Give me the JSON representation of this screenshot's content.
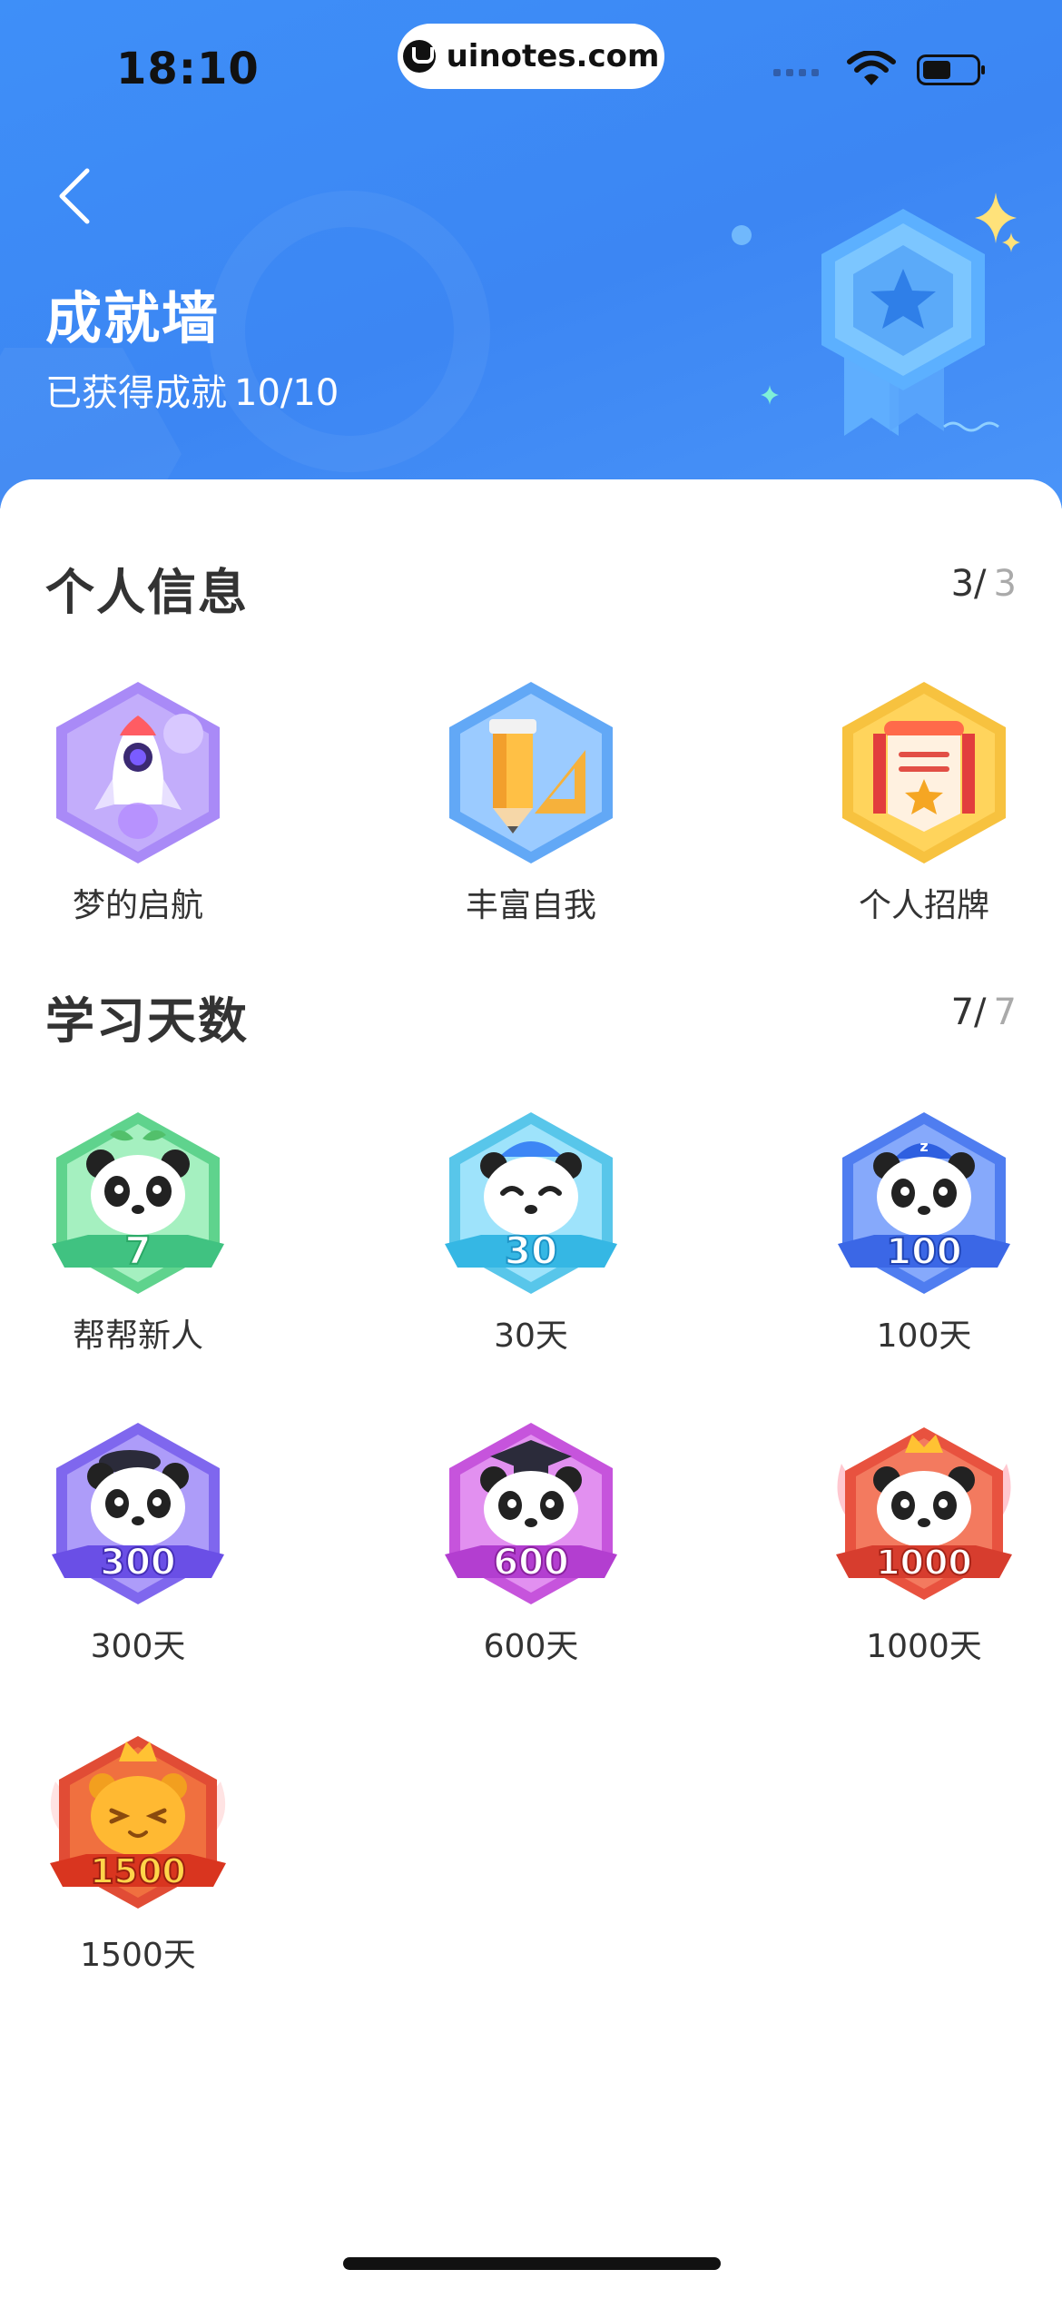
{
  "status_bar": {
    "time": "18:10",
    "url": "uinotes.com"
  },
  "header": {
    "back_icon": "chevron-left-icon",
    "title": "成就墙",
    "progress_label": "已获得成就",
    "progress_value": "10/10",
    "badge_icon": "star-medal-icon"
  },
  "sections": [
    {
      "title": "个人信息",
      "earned": "3/",
      "total": "3",
      "items": [
        {
          "label": "梦的启航",
          "icon": "rocket-badge-icon",
          "color": "#a98af7"
        },
        {
          "label": "丰富自我",
          "icon": "pencil-ruler-badge-icon",
          "color": "#62a8f6"
        },
        {
          "label": "个人招牌",
          "icon": "banner-star-badge-icon",
          "color": "#f7c23f"
        }
      ]
    },
    {
      "title": "学习天数",
      "earned": "7/",
      "total": "7",
      "items": [
        {
          "label": "帮帮新人",
          "icon": "panda-sprout-badge-icon",
          "badge_number": "7",
          "color": "#5fd38d"
        },
        {
          "label": "30天",
          "icon": "panda-cap-badge-icon",
          "badge_number": "30",
          "color": "#58c6ea"
        },
        {
          "label": "100天",
          "icon": "panda-sleep-cap-badge-icon",
          "badge_number": "100",
          "color": "#4f7df0"
        },
        {
          "label": "300天",
          "icon": "panda-beret-badge-icon",
          "badge_number": "300",
          "color": "#7f67ee"
        },
        {
          "label": "600天",
          "icon": "panda-graduate-badge-icon",
          "badge_number": "600",
          "color": "#c654dc"
        },
        {
          "label": "1000天",
          "icon": "panda-crown-wings-badge-icon",
          "badge_number": "1000",
          "color": "#e8523f"
        },
        {
          "label": "1500天",
          "icon": "golden-panda-crown-badge-icon",
          "badge_number": "1500",
          "color": "#f2a22b"
        }
      ]
    }
  ]
}
